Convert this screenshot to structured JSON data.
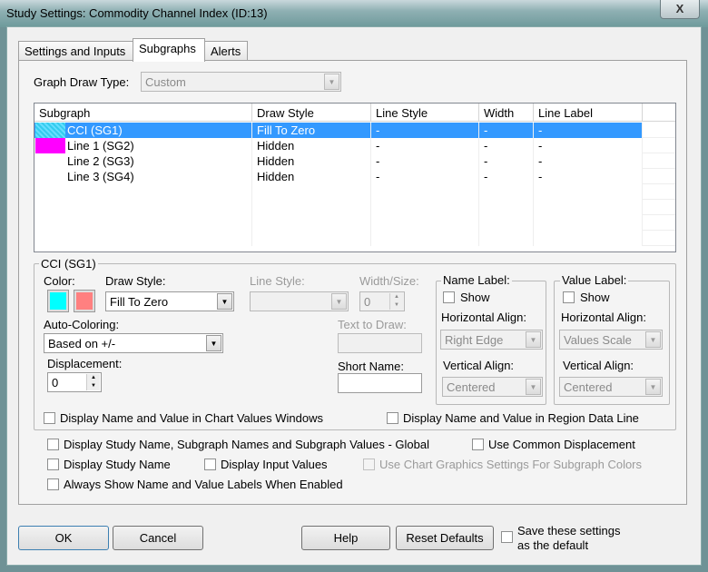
{
  "window": {
    "title": "Study Settings: Commodity Channel Index (ID:13)",
    "close": "X"
  },
  "tabs": [
    {
      "label": "Settings and Inputs"
    },
    {
      "label": "Subgraphs",
      "selected": true
    },
    {
      "label": "Alerts"
    }
  ],
  "graph_draw_type": {
    "label": "Graph Draw Type:",
    "value": "Custom"
  },
  "list": {
    "columns": [
      "Subgraph",
      "Draw Style",
      "Line Style",
      "Width",
      "Line Label"
    ],
    "rows": [
      {
        "name": "CCI (SG1)",
        "draw_style": "Fill To Zero",
        "line_style": "-",
        "width": "-",
        "line_label": "-",
        "swatch": "#33ccee",
        "selected": true
      },
      {
        "name": "Line 1 (SG2)",
        "draw_style": "Hidden",
        "line_style": "-",
        "width": "-",
        "line_label": "-",
        "swatch": "#ff00ff"
      },
      {
        "name": "Line 2 (SG3)",
        "draw_style": "Hidden",
        "line_style": "-",
        "width": "-",
        "line_label": "-"
      },
      {
        "name": "Line 3 (SG4)",
        "draw_style": "Hidden",
        "line_style": "-",
        "width": "-",
        "line_label": "-"
      }
    ]
  },
  "group": {
    "title": "CCI (SG1)",
    "color_label": "Color:",
    "color1": "#00ffff",
    "color2": "#ff8080",
    "draw_style_label": "Draw Style:",
    "draw_style": "Fill To Zero",
    "line_style_label": "Line Style:",
    "line_style": "",
    "width_label": "Width/Size:",
    "width": "0",
    "auto_coloring_label": "Auto-Coloring:",
    "auto_coloring": "Based on +/-",
    "displacement_label": "Displacement:",
    "displacement": "0",
    "text_to_draw_label": "Text to Draw:",
    "text_to_draw": "",
    "short_name_label": "Short Name:",
    "short_name": "",
    "name_label": {
      "title": "Name Label:",
      "show": "Show",
      "h_label": "Horizontal Align:",
      "h_value": "Right Edge",
      "v_label": "Vertical Align:",
      "v_value": "Centered"
    },
    "value_label": {
      "title": "Value Label:",
      "show": "Show",
      "h_label": "Horizontal Align:",
      "h_value": "Values Scale",
      "v_label": "Vertical Align:",
      "v_value": "Centered"
    },
    "chk_chart_values": "Display Name and Value in Chart Values Windows",
    "chk_region": "Display Name and Value in Region Data Line"
  },
  "options": {
    "global": "Display Study Name, Subgraph Names and Subgraph Values - Global",
    "common_disp": "Use Common Displacement",
    "study_name": "Display Study Name",
    "input_values": "Display Input Values",
    "chart_graphics": "Use Chart Graphics Settings For Subgraph Colors",
    "always_show": "Always Show Name and Value Labels When Enabled"
  },
  "buttons": {
    "ok": "OK",
    "cancel": "Cancel",
    "help": "Help",
    "reset": "Reset Defaults",
    "save_line1": "Save these settings",
    "save_line2": "as the default"
  }
}
